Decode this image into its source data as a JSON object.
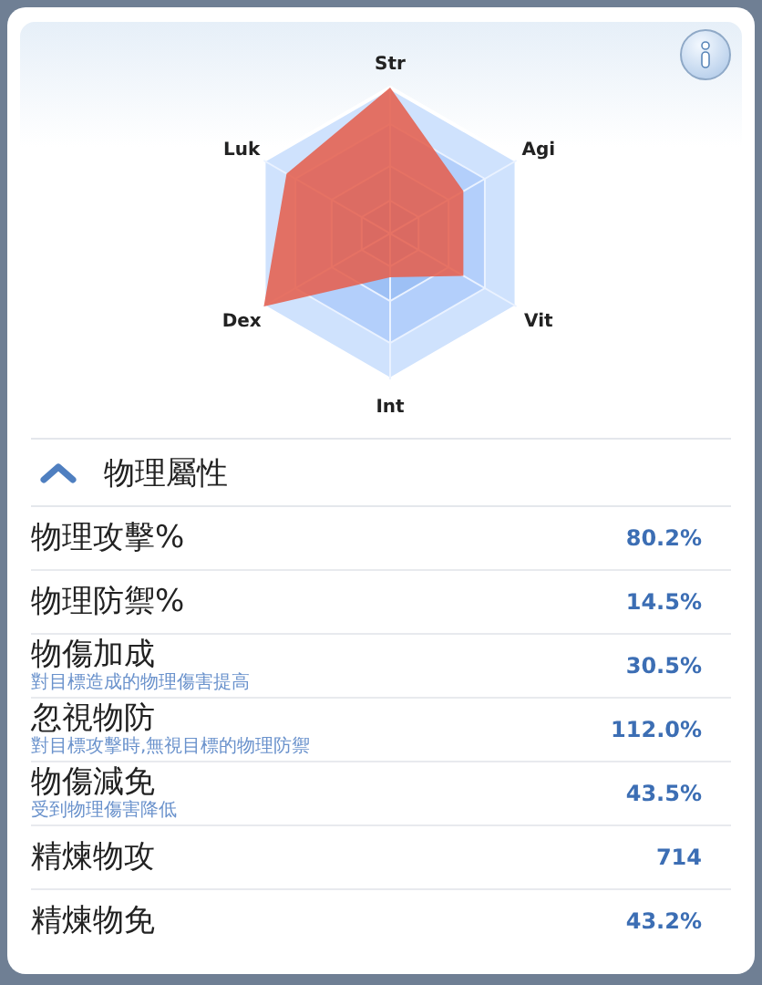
{
  "radar": {
    "axes": [
      "Str",
      "Agi",
      "Vit",
      "Int",
      "Dex",
      "Luk"
    ]
  },
  "section": {
    "title": "物理屬性",
    "expanded": true
  },
  "rows": [
    {
      "label": "物理攻擊%",
      "value": "80.2%"
    },
    {
      "label": "物理防禦%",
      "value": "14.5%"
    },
    {
      "label": "物傷加成",
      "description": "對目標造成的物理傷害提高",
      "value": "30.5%"
    },
    {
      "label": "忽視物防",
      "description": "對目標攻擊時,無視目標的物理防禦",
      "value": "112.0%"
    },
    {
      "label": "物傷減免",
      "description": "受到物理傷害降低",
      "value": "43.5%"
    },
    {
      "label": "精煉物攻",
      "value": "714"
    },
    {
      "label": "精煉物免",
      "value": "43.2%"
    }
  ]
}
